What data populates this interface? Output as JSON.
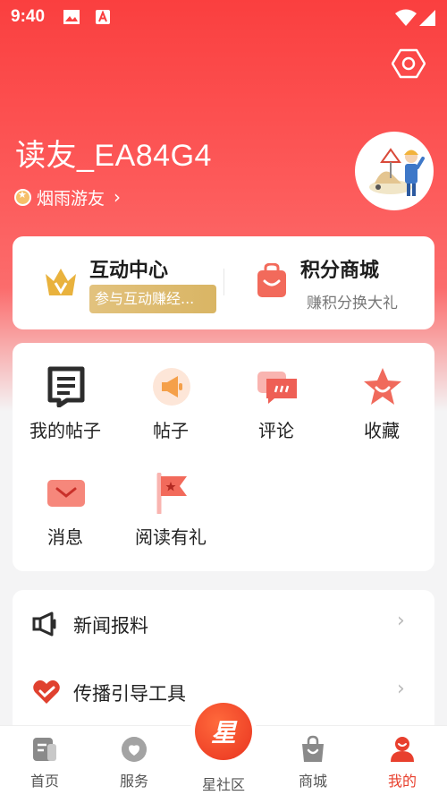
{
  "status_bar": {
    "time": "9:40"
  },
  "profile": {
    "username": "读友_EA84G4",
    "level": "烟雨游友"
  },
  "hub": {
    "interaction": {
      "title": "互动中心",
      "subtitle": "参与互动赚经..."
    },
    "points_mall": {
      "title": "积分商城",
      "subtitle": "赚积分换大礼"
    }
  },
  "grid": [
    {
      "label": "我的帖子",
      "icon": "document-icon"
    },
    {
      "label": "帖子",
      "icon": "megaphone-icon"
    },
    {
      "label": "评论",
      "icon": "comment-icon"
    },
    {
      "label": "收藏",
      "icon": "star-icon"
    },
    {
      "label": "消息",
      "icon": "envelope-icon"
    },
    {
      "label": "阅读有礼",
      "icon": "flag-icon"
    }
  ],
  "list": [
    {
      "label": "新闻报料",
      "icon": "megaphone-outline-icon"
    },
    {
      "label": "传播引导工具",
      "icon": "heart-icon"
    }
  ],
  "tabs": [
    {
      "label": "首页",
      "icon": "newspaper-icon"
    },
    {
      "label": "服务",
      "icon": "service-icon"
    },
    {
      "label": "星社区",
      "icon": "star-community-icon",
      "emblem": "星"
    },
    {
      "label": "商城",
      "icon": "shopping-bag-icon"
    },
    {
      "label": "我的",
      "icon": "user-icon",
      "active": true
    }
  ],
  "colors": {
    "brand": "#fa3f3f",
    "active_tab": "#e8402e",
    "gold": "#d9b564"
  }
}
